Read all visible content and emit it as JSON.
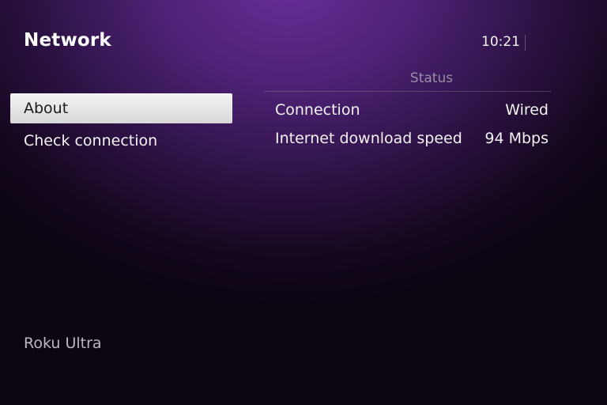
{
  "header": {
    "title": "Network",
    "clock": "10:21"
  },
  "menu": {
    "items": [
      {
        "label": "About",
        "selected": true
      },
      {
        "label": "Check connection",
        "selected": false
      }
    ]
  },
  "status": {
    "header": "Status",
    "rows": [
      {
        "label": "Connection",
        "value": "Wired"
      },
      {
        "label": "Internet download speed",
        "value": "94 Mbps"
      }
    ]
  },
  "device": {
    "name": "Roku Ultra"
  },
  "colors": {
    "background_accent": "#6a2e9a",
    "selected_item_background": "#eeeeee",
    "muted_text": "#9a8ea6"
  }
}
